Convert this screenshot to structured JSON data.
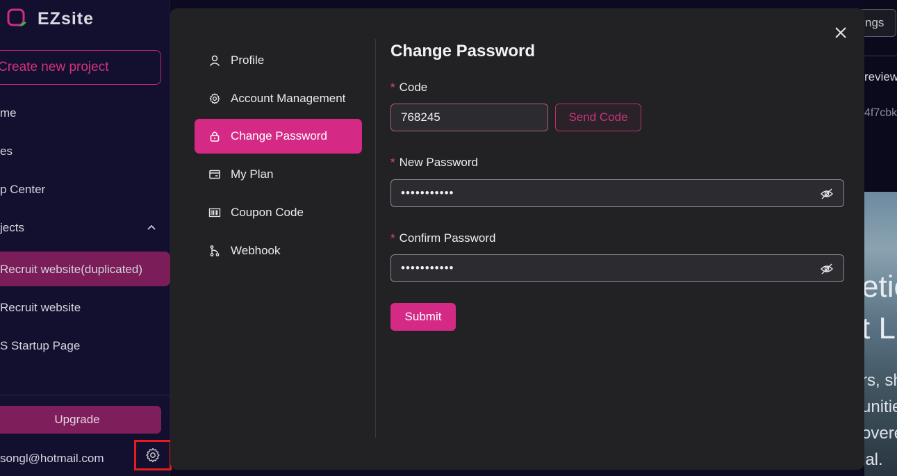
{
  "app": {
    "logo_text": "EZsite",
    "create_label": "Create new project",
    "nav": [
      {
        "label": "me"
      },
      {
        "label": "es"
      },
      {
        "label": "p Center"
      }
    ],
    "projects_label": "jects",
    "projects": [
      {
        "label": "Recruit website(duplicated)",
        "active": true
      },
      {
        "label": "Recruit website",
        "active": false
      },
      {
        "label": "S Startup Page",
        "active": false
      }
    ],
    "upgrade_label": "Upgrade",
    "email": "songl@hotmail.com"
  },
  "background": {
    "settings_label": "ngs",
    "preview_label": "review",
    "hash_label": "4f7cbk",
    "hero_line1": "etic",
    "hero_line2": "t L",
    "hero_small1": "rs, sh",
    "hero_small2": "unitie",
    "hero_small3": "overe",
    "hero_small4": "ial."
  },
  "modal": {
    "menu": [
      {
        "label": "Profile",
        "icon": "user-icon"
      },
      {
        "label": "Account Management",
        "icon": "gear-icon"
      },
      {
        "label": "Change Password",
        "icon": "lock-icon",
        "active": true
      },
      {
        "label": "My Plan",
        "icon": "card-icon"
      },
      {
        "label": "Coupon Code",
        "icon": "barcode-icon"
      },
      {
        "label": "Webhook",
        "icon": "webhook-icon"
      }
    ],
    "form": {
      "title": "Change Password",
      "required_mark": "*",
      "code_label": "Code",
      "code_value": "768245",
      "send_code_label": "Send Code",
      "new_password_label": "New Password",
      "new_password_value": "•••••••••••",
      "confirm_password_label": "Confirm Password",
      "confirm_password_value": "•••••••••••",
      "submit_label": "Submit"
    }
  },
  "colors": {
    "accent": "#d42a86",
    "sidebar_bg": "#12102e",
    "modal_bg": "#222225",
    "highlight": "#e81c1c"
  }
}
